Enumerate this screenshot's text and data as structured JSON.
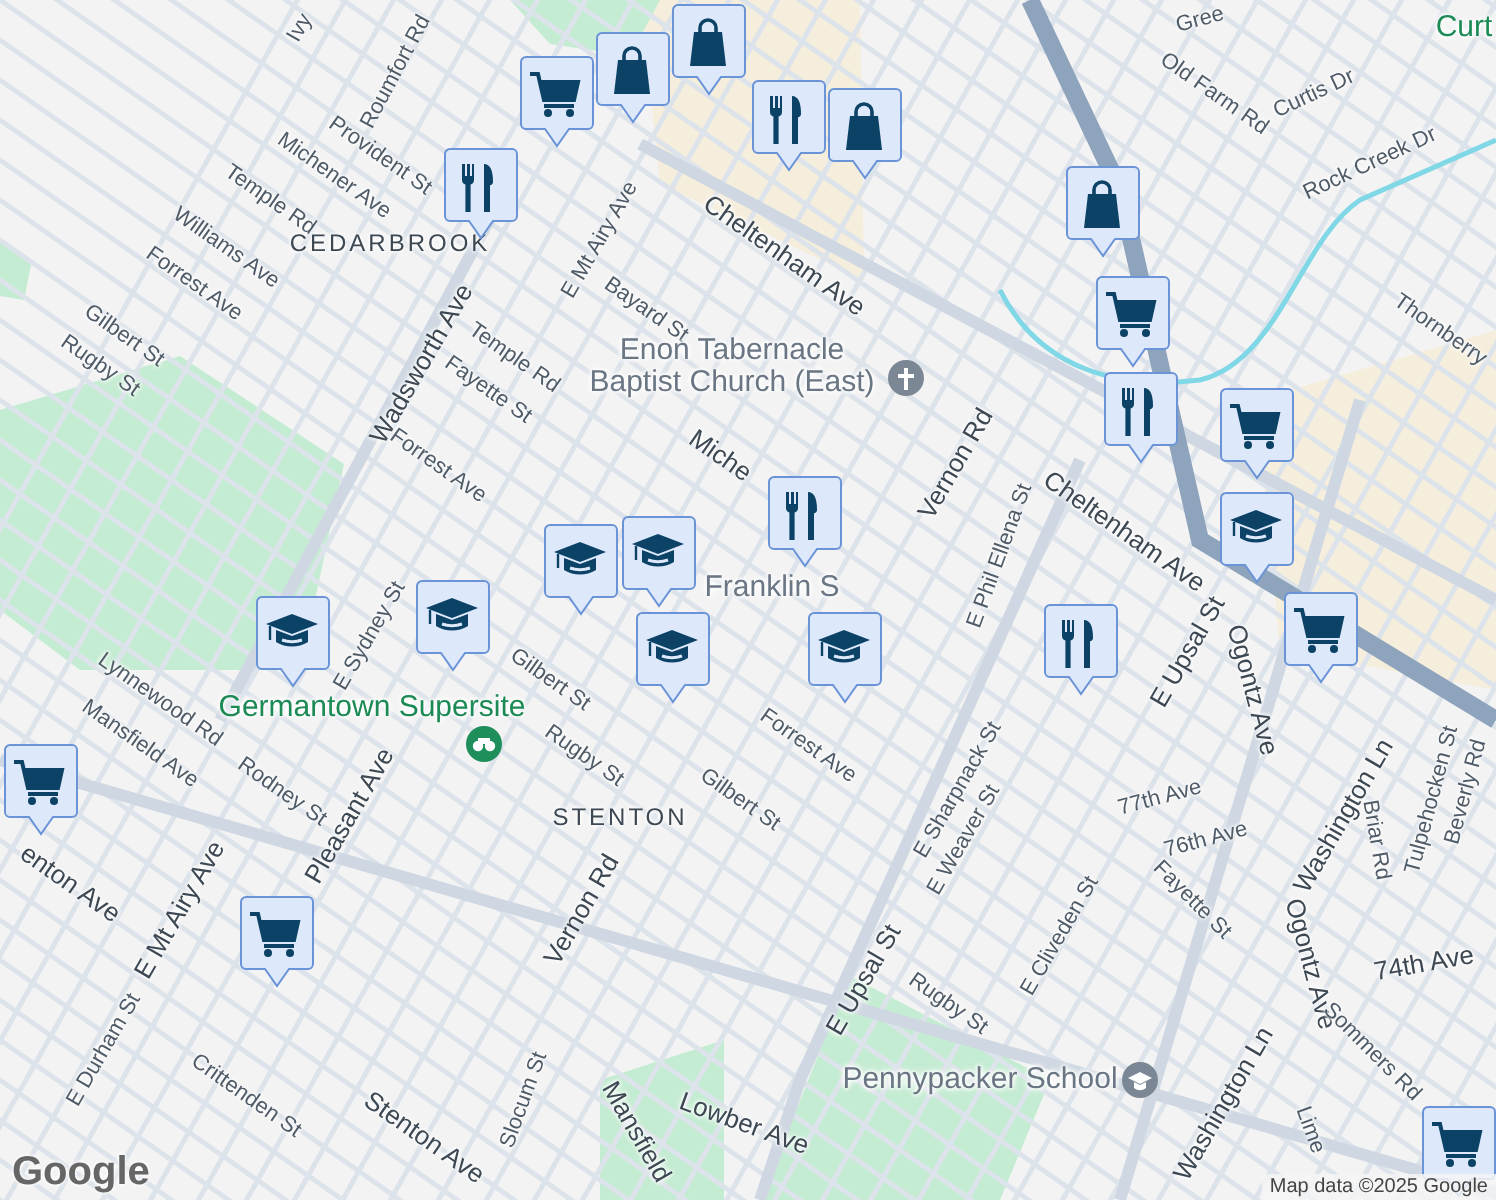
{
  "labels": [
    {
      "text": "Ivy",
      "kind": "street"
    },
    {
      "text": "Roumfort Rd",
      "kind": "street"
    },
    {
      "text": "Provident St",
      "kind": "street"
    },
    {
      "text": "Michener Ave",
      "kind": "street"
    },
    {
      "text": "Temple Rd",
      "kind": "street"
    },
    {
      "text": "CEDARBROOK",
      "kind": "district"
    },
    {
      "text": "Williams Ave",
      "kind": "street"
    },
    {
      "text": "Forrest Ave",
      "kind": "street"
    },
    {
      "text": "Gilbert St",
      "kind": "street"
    },
    {
      "text": "Rugby St",
      "kind": "street"
    },
    {
      "text": "E Mt Airy Ave",
      "kind": "street"
    },
    {
      "text": "Bayard St",
      "kind": "street"
    },
    {
      "text": "Wadsworth Ave",
      "kind": "major"
    },
    {
      "text": "Temple Rd",
      "kind": "street"
    },
    {
      "text": "Fayette St",
      "kind": "street"
    },
    {
      "text": "Forrest Ave",
      "kind": "street"
    },
    {
      "text": "Cheltenham Ave",
      "kind": "major"
    },
    {
      "text": "Vernon Rd",
      "kind": "major"
    },
    {
      "text": "Cheltenham Ave",
      "kind": "major"
    },
    {
      "text": "E Phil Ellena St",
      "kind": "street"
    },
    {
      "text": "Miche",
      "kind": "major"
    },
    {
      "text": "Old Farm Rd",
      "kind": "street"
    },
    {
      "text": "Curtis Dr",
      "kind": "street"
    },
    {
      "text": "Rock Creek Dr",
      "kind": "street"
    },
    {
      "text": "Thornberry",
      "kind": "street"
    },
    {
      "text": "E Sydney St",
      "kind": "street"
    },
    {
      "text": "Gilbert St",
      "kind": "street"
    },
    {
      "text": "Rugby St",
      "kind": "street"
    },
    {
      "text": "Lynnewood Rd",
      "kind": "street"
    },
    {
      "text": "Mansfield Ave",
      "kind": "street"
    },
    {
      "text": "Rodney St",
      "kind": "street"
    },
    {
      "text": "enton Ave",
      "kind": "major"
    },
    {
      "text": "E Mt Airy Ave",
      "kind": "major"
    },
    {
      "text": "STENTON",
      "kind": "district"
    },
    {
      "text": "Vernon Rd",
      "kind": "major"
    },
    {
      "text": "Pleasant Ave",
      "kind": "major"
    },
    {
      "text": "E Durham St",
      "kind": "street"
    },
    {
      "text": "Crittenden St",
      "kind": "street"
    },
    {
      "text": "Slocum St",
      "kind": "street"
    },
    {
      "text": "Stenton Ave",
      "kind": "major"
    },
    {
      "text": "Mansfield",
      "kind": "major"
    },
    {
      "text": "Forrest Ave",
      "kind": "street"
    },
    {
      "text": "Gilbert St",
      "kind": "street"
    },
    {
      "text": "E Sharpnack St",
      "kind": "street"
    },
    {
      "text": "E Weaver St",
      "kind": "street"
    },
    {
      "text": "E Upsal St",
      "kind": "major"
    },
    {
      "text": "77th Ave",
      "kind": "street"
    },
    {
      "text": "76th Ave",
      "kind": "street"
    },
    {
      "text": "Fayette St",
      "kind": "street"
    },
    {
      "text": "E Cliveden St",
      "kind": "street"
    },
    {
      "text": "Washington Ln",
      "kind": "major"
    },
    {
      "text": "Ogontz Ave",
      "kind": "major"
    },
    {
      "text": "Ogontz Ave",
      "kind": "major"
    },
    {
      "text": "Briar Rd",
      "kind": "street"
    },
    {
      "text": "Tulpehocken St",
      "kind": "street"
    },
    {
      "text": "Beverly Rd",
      "kind": "street"
    },
    {
      "text": "74th Ave",
      "kind": "major"
    },
    {
      "text": "E Upsal St",
      "kind": "major"
    },
    {
      "text": "Rugby St",
      "kind": "street"
    },
    {
      "text": "Washington Ln",
      "kind": "major"
    },
    {
      "text": "Sommers Rd",
      "kind": "street"
    },
    {
      "text": "Lowber Ave",
      "kind": "major"
    },
    {
      "text": "Lime",
      "kind": "street"
    },
    {
      "text": "Gree",
      "kind": "street"
    }
  ],
  "places": [
    {
      "name": "Enon Tabernacle\nBaptist Church (East)",
      "kind": "church"
    },
    {
      "name": "Franklin S",
      "kind": "text"
    },
    {
      "name": "Germantown Supersite",
      "kind": "park"
    },
    {
      "name": "Pennypacker School",
      "kind": "school"
    },
    {
      "name": "Curt",
      "kind": "park_text"
    }
  ],
  "markers": [
    {
      "kind": "shopping"
    },
    {
      "kind": "shopping"
    },
    {
      "kind": "grocery"
    },
    {
      "kind": "restaurant"
    },
    {
      "kind": "restaurant"
    },
    {
      "kind": "shopping"
    },
    {
      "kind": "shopping"
    },
    {
      "kind": "grocery"
    },
    {
      "kind": "restaurant"
    },
    {
      "kind": "grocery"
    },
    {
      "kind": "school"
    },
    {
      "kind": "grocery"
    },
    {
      "kind": "restaurant"
    },
    {
      "kind": "restaurant"
    },
    {
      "kind": "school"
    },
    {
      "kind": "school"
    },
    {
      "kind": "school"
    },
    {
      "kind": "school"
    },
    {
      "kind": "school"
    },
    {
      "kind": "school"
    },
    {
      "kind": "grocery"
    },
    {
      "kind": "grocery"
    },
    {
      "kind": "grocery"
    }
  ],
  "logo": "Google",
  "attribution": "Map data ©2025 Google"
}
